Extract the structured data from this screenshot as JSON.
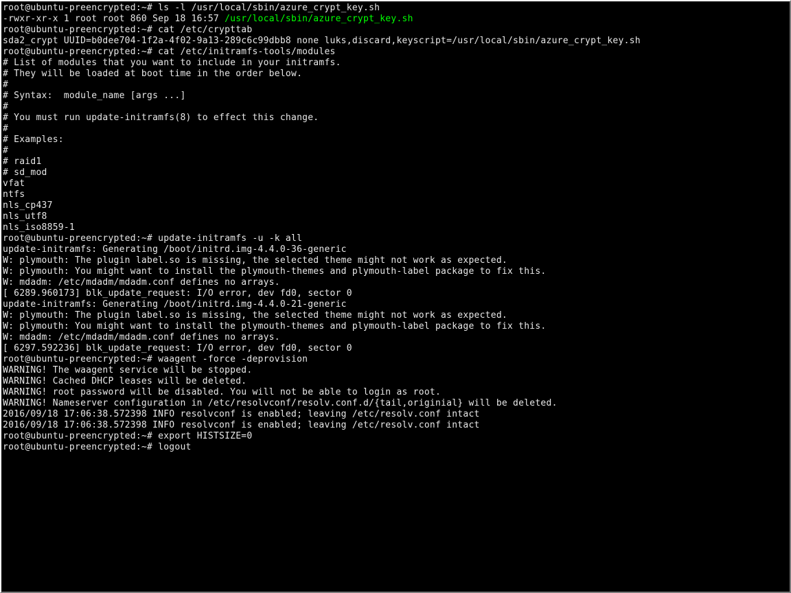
{
  "prompt": "root@ubuntu-preencrypted:~# ",
  "lines": [
    {
      "type": "cmd",
      "cmd": "ls -l /usr/local/sbin/azure_crypt_key.sh"
    },
    {
      "type": "lsout",
      "pre": "-rwxr-xr-x 1 root root 860 Sep 18 16:57 ",
      "path": "/usr/local/sbin/azure_crypt_key.sh"
    },
    {
      "type": "cmd",
      "cmd": "cat /etc/crypttab"
    },
    {
      "type": "out",
      "text": "sda2_crypt UUID=b0dee704-1f2a-4f02-9a13-289c6c99dbb8 none luks,discard,keyscript=/usr/local/sbin/azure_crypt_key.sh"
    },
    {
      "type": "cmd",
      "cmd": "cat /etc/initramfs-tools/modules"
    },
    {
      "type": "out",
      "text": "# List of modules that you want to include in your initramfs."
    },
    {
      "type": "out",
      "text": "# They will be loaded at boot time in the order below."
    },
    {
      "type": "out",
      "text": "#"
    },
    {
      "type": "out",
      "text": "# Syntax:  module_name [args ...]"
    },
    {
      "type": "out",
      "text": "#"
    },
    {
      "type": "out",
      "text": "# You must run update-initramfs(8) to effect this change."
    },
    {
      "type": "out",
      "text": "#"
    },
    {
      "type": "out",
      "text": "# Examples:"
    },
    {
      "type": "out",
      "text": "#"
    },
    {
      "type": "out",
      "text": "# raid1"
    },
    {
      "type": "out",
      "text": "# sd_mod"
    },
    {
      "type": "out",
      "text": "vfat"
    },
    {
      "type": "out",
      "text": "ntfs"
    },
    {
      "type": "out",
      "text": "nls_cp437"
    },
    {
      "type": "out",
      "text": "nls_utf8"
    },
    {
      "type": "out",
      "text": "nls_iso8859-1"
    },
    {
      "type": "cmd",
      "cmd": "update-initramfs -u -k all"
    },
    {
      "type": "out",
      "text": "update-initramfs: Generating /boot/initrd.img-4.4.0-36-generic"
    },
    {
      "type": "out",
      "text": "W: plymouth: The plugin label.so is missing, the selected theme might not work as expected."
    },
    {
      "type": "out",
      "text": "W: plymouth: You might want to install the plymouth-themes and plymouth-label package to fix this."
    },
    {
      "type": "out",
      "text": "W: mdadm: /etc/mdadm/mdadm.conf defines no arrays."
    },
    {
      "type": "out",
      "text": "[ 6289.960173] blk_update_request: I/O error, dev fd0, sector 0"
    },
    {
      "type": "out",
      "text": "update-initramfs: Generating /boot/initrd.img-4.4.0-21-generic"
    },
    {
      "type": "out",
      "text": "W: plymouth: The plugin label.so is missing, the selected theme might not work as expected."
    },
    {
      "type": "out",
      "text": "W: plymouth: You might want to install the plymouth-themes and plymouth-label package to fix this."
    },
    {
      "type": "out",
      "text": "W: mdadm: /etc/mdadm/mdadm.conf defines no arrays."
    },
    {
      "type": "out",
      "text": "[ 6297.592236] blk_update_request: I/O error, dev fd0, sector 0"
    },
    {
      "type": "cmd",
      "cmd": "waagent -force -deprovision"
    },
    {
      "type": "out",
      "text": "WARNING! The waagent service will be stopped."
    },
    {
      "type": "out",
      "text": "WARNING! Cached DHCP leases will be deleted."
    },
    {
      "type": "out",
      "text": "WARNING! root password will be disabled. You will not be able to login as root."
    },
    {
      "type": "out",
      "text": "WARNING! Nameserver configuration in /etc/resolvconf/resolv.conf.d/{tail,originial} will be deleted."
    },
    {
      "type": "out",
      "text": "2016/09/18 17:06:38.572398 INFO resolvconf is enabled; leaving /etc/resolv.conf intact"
    },
    {
      "type": "out",
      "text": "2016/09/18 17:06:38.572398 INFO resolvconf is enabled; leaving /etc/resolv.conf intact"
    },
    {
      "type": "cmd",
      "cmd": "export HISTSIZE=0"
    },
    {
      "type": "cmd",
      "cmd": "logout"
    }
  ]
}
